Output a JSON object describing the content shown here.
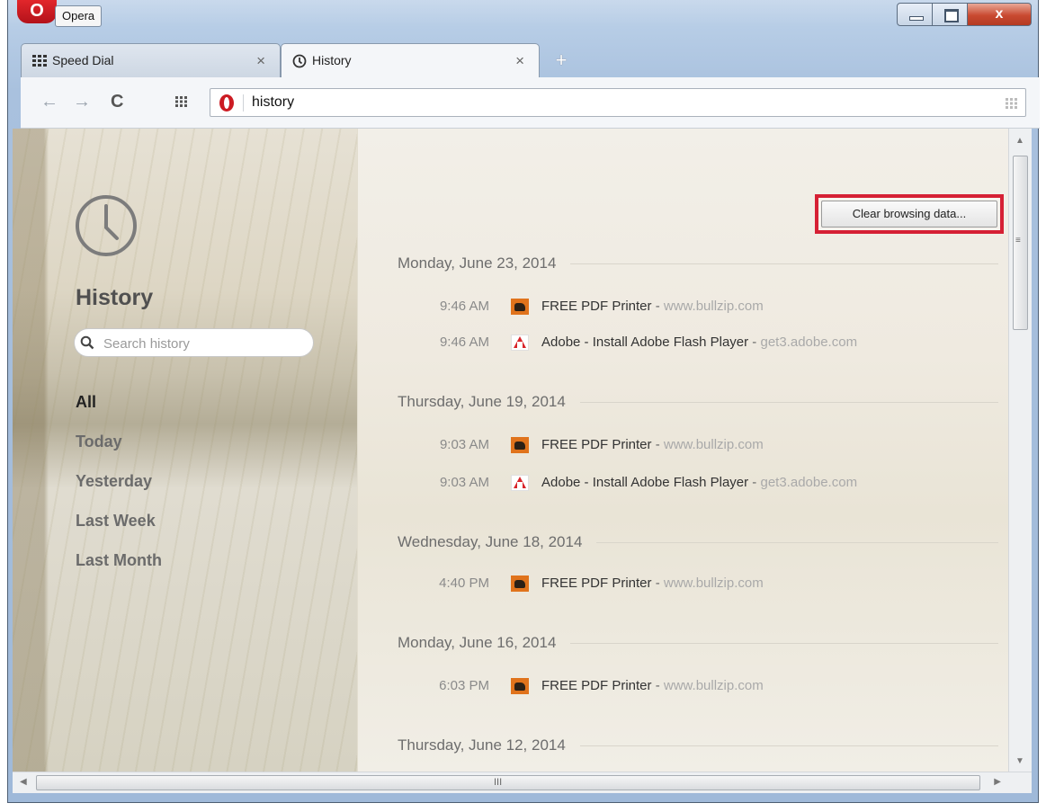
{
  "window": {
    "app_name": "Opera",
    "close_glyph": "x",
    "badge": "O"
  },
  "tabs": [
    {
      "label": "Speed Dial",
      "icon": "speed-dial-grid-icon",
      "close": "×"
    },
    {
      "label": "History",
      "icon": "clock-icon",
      "close": "×"
    }
  ],
  "new_tab_glyph": "+",
  "toolbar": {
    "back_glyph": "←",
    "forward_glyph": "→",
    "reload_glyph": "C",
    "address_value": "history"
  },
  "sidebar": {
    "title": "History",
    "search_placeholder": "Search history",
    "nav": [
      "All",
      "Today",
      "Yesterday",
      "Last Week",
      "Last Month"
    ],
    "active_nav": "All"
  },
  "main": {
    "clear_button": "Clear browsing data...",
    "days": [
      {
        "date": "Monday, June 23, 2014",
        "entries": [
          {
            "time": "9:46 AM",
            "favicon": "bullzip-icon",
            "title": "FREE PDF Printer",
            "domain": "www.bullzip.com"
          },
          {
            "time": "9:46 AM",
            "favicon": "adobe-icon",
            "title": "Adobe - Install Adobe Flash Player",
            "domain": "get3.adobe.com"
          }
        ]
      },
      {
        "date": "Thursday, June 19, 2014",
        "entries": [
          {
            "time": "9:03 AM",
            "favicon": "bullzip-icon",
            "title": "FREE PDF Printer",
            "domain": "www.bullzip.com"
          },
          {
            "time": "9:03 AM",
            "favicon": "adobe-icon",
            "title": "Adobe - Install Adobe Flash Player",
            "domain": "get3.adobe.com"
          }
        ]
      },
      {
        "date": "Wednesday, June 18, 2014",
        "entries": [
          {
            "time": "4:40 PM",
            "favicon": "bullzip-icon",
            "title": "FREE PDF Printer",
            "domain": "www.bullzip.com"
          }
        ]
      },
      {
        "date": "Monday, June 16, 2014",
        "entries": [
          {
            "time": "6:03 PM",
            "favicon": "bullzip-icon",
            "title": "FREE PDF Printer",
            "domain": "www.bullzip.com"
          }
        ]
      },
      {
        "date": "Thursday, June 12, 2014",
        "entries": []
      }
    ],
    "separator": " - "
  },
  "scrollbars": {
    "grip": "≡",
    "h_grip": "III"
  },
  "colors": {
    "highlight_box": "#d62034",
    "opera_red": "#cc1b23",
    "domain_text": "#a9a9a9"
  }
}
